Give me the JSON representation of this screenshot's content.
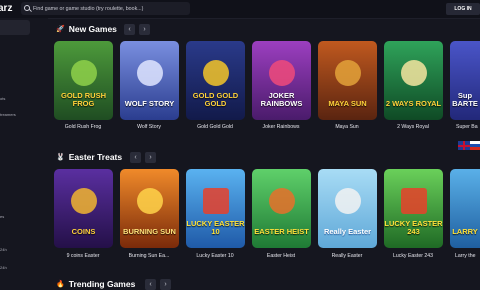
{
  "header": {
    "logo": "arz",
    "search_placeholder": "Find game or game studio (try roulette, book...)",
    "login_label": "LOG IN"
  },
  "sidebar": {
    "items": [
      {
        "label": "ots"
      },
      {
        "label": "treamers"
      },
      {
        "label": "es"
      },
      {
        "label": "24h"
      },
      {
        "label": "24h"
      }
    ]
  },
  "sections": [
    {
      "title": "New Games",
      "icon": "rocket-icon",
      "games": [
        {
          "name": "Gold Rush Frog",
          "art_text": "GOLD RUSH FROG",
          "color": "#2e6b2f"
        },
        {
          "name": "Wolf Story",
          "art_text": "WOLF STORY",
          "color": "#3b4d9c"
        },
        {
          "name": "Gold Gold Gold",
          "art_text": "GOLD GOLD GOLD",
          "color": "#1e2d6b"
        },
        {
          "name": "Joker Rainbows",
          "art_text": "JOKER RAINBOWS",
          "color": "#6b2c8f"
        },
        {
          "name": "Maya Sun",
          "art_text": "MAYA SUN",
          "color": "#7a3414"
        },
        {
          "name": "2 Ways Royal",
          "art_text": "2 WAYS ROYAL",
          "color": "#1f6b39"
        },
        {
          "name": "Super Ba",
          "art_text": "Sup BARTE",
          "color": "#3a3fa0"
        }
      ]
    },
    {
      "title": "Easter Treats",
      "icon": "bunny-icon",
      "games": [
        {
          "name": "9 coins Easter",
          "art_text": "COINS",
          "color": "#3e236f"
        },
        {
          "name": "Burning Sun Ea...",
          "art_text": "BURNING SUN",
          "color": "#b5521a"
        },
        {
          "name": "Lucky Easter 10",
          "art_text": "LUCKY EASTER 10",
          "color": "#3c8ad1"
        },
        {
          "name": "Easter Heist",
          "art_text": "EASTER HEIST",
          "color": "#2f9a4a"
        },
        {
          "name": "Really Easter",
          "art_text": "Really Easter",
          "color": "#7cc0e8"
        },
        {
          "name": "Lucky Easter 243",
          "art_text": "LUCKY EASTER 243",
          "color": "#3a8f3a"
        },
        {
          "name": "Larry the",
          "art_text": "LARRY",
          "color": "#2f7fc2"
        }
      ]
    },
    {
      "title": "Trending Games",
      "icon": "fire-icon"
    }
  ],
  "nav": {
    "prev": "‹",
    "next": "›"
  }
}
